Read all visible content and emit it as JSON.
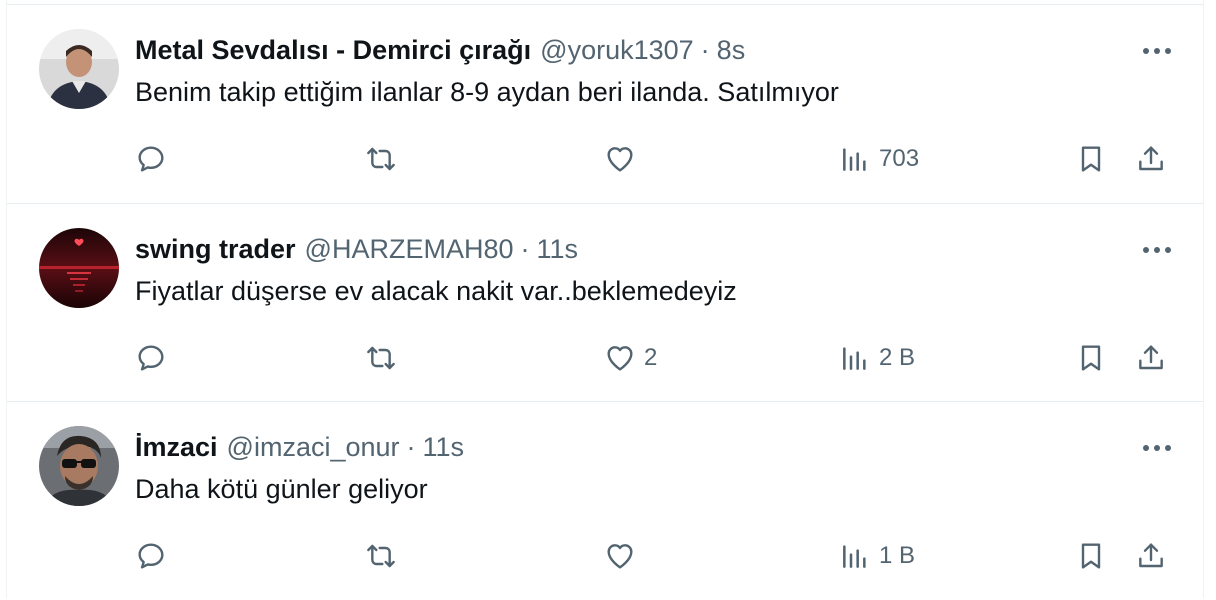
{
  "tweets": [
    {
      "display_name": "Metal Sevdalısı - Demirci çırağı",
      "handle": "@yoruk1307",
      "separator": "·",
      "time": "8s",
      "text": "Benim takip ettiğim ilanlar 8-9  aydan beri ilanda.  Satılmıyor",
      "replies": "",
      "retweets": "",
      "likes": "",
      "views": "703"
    },
    {
      "display_name": "swing trader",
      "handle": "@HARZEMAH80",
      "separator": "·",
      "time": "11s",
      "text": "Fiyatlar düşerse ev alacak nakit var..beklemedeyiz",
      "replies": "",
      "retweets": "",
      "likes": "2",
      "views": "2 B"
    },
    {
      "display_name": "İmzaci",
      "handle": "@imzaci_onur",
      "separator": "·",
      "time": "11s",
      "text": "Daha kötü günler geliyor",
      "replies": "",
      "retweets": "",
      "likes": "",
      "views": "1 B"
    }
  ],
  "icons": {
    "reply": "speech-bubble-icon",
    "retweet": "retweet-arrows-icon",
    "like": "heart-icon",
    "views": "bar-chart-icon",
    "bookmark": "bookmark-icon",
    "share": "share-upload-icon",
    "more": "more-dots-icon"
  },
  "colors": {
    "text": "#0f1419",
    "secondary": "#536471",
    "border": "#e6ecf0"
  }
}
